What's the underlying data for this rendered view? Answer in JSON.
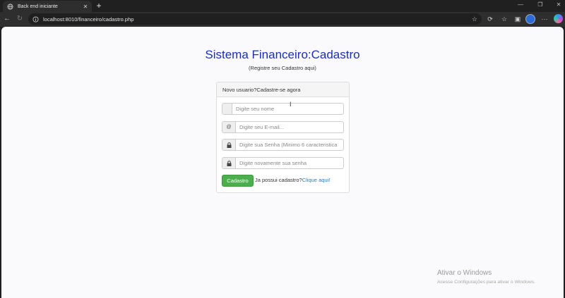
{
  "browser": {
    "tab_title": "Back end iniciante",
    "url": "localhost:8010/financeiro/cadastro.php"
  },
  "page": {
    "title": "Sistema Financeiro:Cadastro",
    "subtitle": "(Registre seu Cadastro aqui)"
  },
  "form": {
    "heading": "Novo usuario?Cadastre-se agora",
    "name": {
      "placeholder": "Digite seu nome",
      "value": ""
    },
    "email": {
      "addon": "@",
      "placeholder": "Digite seu E-mail...",
      "value": ""
    },
    "password": {
      "placeholder": "Digite sua Senha (Minimo 6 caracteristica",
      "value": ""
    },
    "password_confirm": {
      "placeholder": "Digite novamente sua senha",
      "value": ""
    },
    "submit_label": "Cadastro",
    "login_prompt": "Ja possui cadastro?",
    "login_link": "Clique aqui!"
  },
  "watermark": {
    "title": "Ativar o Windows",
    "subtitle": "Acesse Configurações para ativar o Windows."
  },
  "colors": {
    "title": "#1b2fb8",
    "submit_button": "#4cae4c",
    "link": "#337ab7"
  }
}
